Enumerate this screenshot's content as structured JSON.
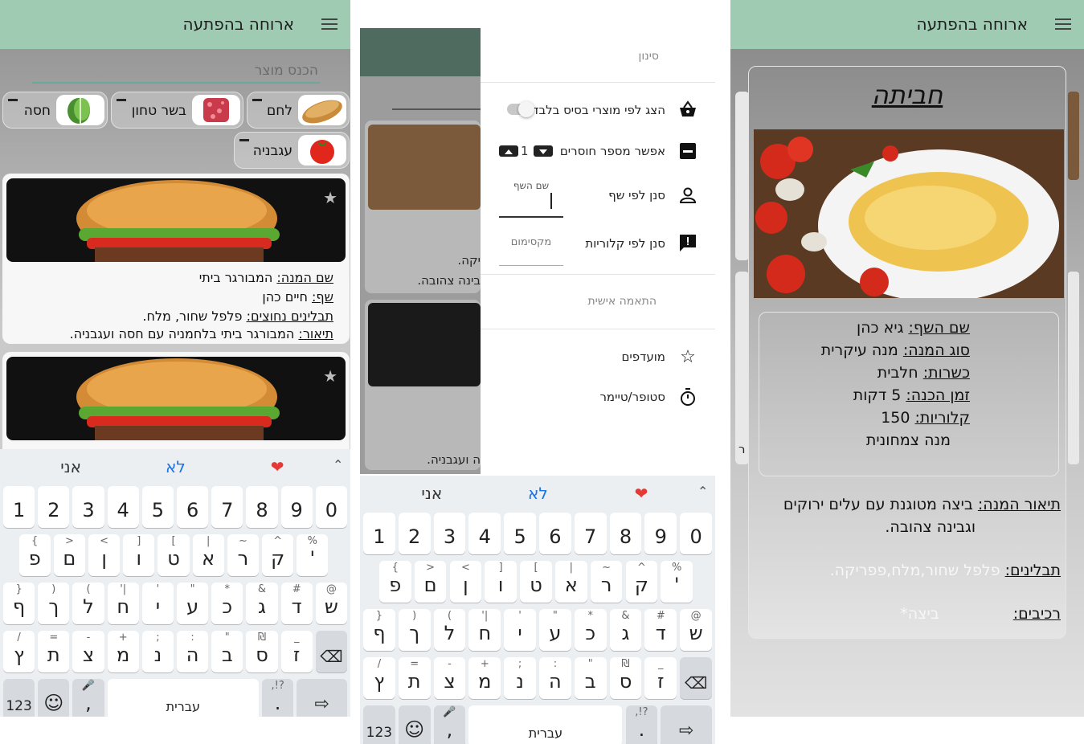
{
  "app": {
    "title": "ארוחה בהפתעה"
  },
  "screen1": {
    "search_placeholder": "הכנס מוצר",
    "chips": [
      "לחם",
      "בשר טחון",
      "חסה",
      "עגבניה"
    ],
    "cards": [
      {
        "name_label": "שם המנה:",
        "name": "המבורגר ביתי",
        "chef_label": "שף:",
        "chef": "חיים כהן",
        "spices_label": "תבלינים נחוצים:",
        "spices": "פלפל שחור, מלח.",
        "desc_label": "תיאור:",
        "desc": "המבורגר ביתי בלחמניה עם חסה ועגבניה."
      }
    ]
  },
  "keyboard": {
    "suggestions": [
      "אני",
      "לא",
      "❤"
    ],
    "numbers": [
      "1",
      "2",
      "3",
      "4",
      "5",
      "6",
      "7",
      "8",
      "9",
      "0"
    ],
    "row2": [
      [
        "%",
        "'"
      ],
      [
        "^",
        "ק"
      ],
      [
        "~",
        "ר"
      ],
      [
        "|",
        "א"
      ],
      [
        "[",
        "ט"
      ],
      [
        "]",
        "ו"
      ],
      [
        "<",
        "ן"
      ],
      [
        ">",
        "ם"
      ],
      [
        "{",
        "פ"
      ]
    ],
    "row3": [
      [
        "@",
        "ש"
      ],
      [
        "#",
        "ד"
      ],
      [
        "&",
        "ג"
      ],
      [
        "*",
        "כ"
      ],
      [
        "\"",
        "ע"
      ],
      [
        "'",
        "י"
      ],
      [
        "'|",
        "ח"
      ],
      [
        "(",
        "ל"
      ],
      [
        ")",
        "ך"
      ],
      [
        "}",
        "ף"
      ]
    ],
    "row4": [
      [
        "_",
        "ז"
      ],
      [
        "₪",
        "ס"
      ],
      [
        "\"",
        "ב"
      ],
      [
        ":",
        "ה"
      ],
      [
        ";",
        "נ"
      ],
      [
        "+",
        "מ"
      ],
      [
        "-",
        "צ"
      ],
      [
        "=",
        "ת"
      ],
      [
        "/",
        "ץ"
      ]
    ],
    "num_key": "123",
    "space_label": "עברית",
    "comma": ",",
    "period": ".",
    "punct_hint": ",!?"
  },
  "screen2": {
    "section_filter": "סינון",
    "items": [
      {
        "label": "הצג לפי מוצרי בסיס בלבד"
      },
      {
        "label": "אפשר מספר חוסרים",
        "value": "1"
      },
      {
        "label": "סנן לפי שף",
        "hint": "שם השף"
      },
      {
        "label": "סנן לפי קלוריות",
        "hint": "מקסימום"
      }
    ],
    "section_personal": "התאמה אישית",
    "favorites": "מועדפים",
    "stopwatch": "סטופר/טיימר",
    "bg_snippets": [
      "יקה.",
      "בינה צהובה.",
      "ה ועגבניה."
    ]
  },
  "screen3": {
    "title": "חביתה",
    "info": [
      {
        "label": "שם השף:",
        "value": "גיא כהן"
      },
      {
        "label": "סוג המנה:",
        "value": "מנה עיקרית"
      },
      {
        "label": "כשרות:",
        "value": "חלבית"
      },
      {
        "label": "זמן הכנה:",
        "value": "5 דקות"
      },
      {
        "label": "קלוריות:",
        "value": "150"
      }
    ],
    "vegetarian": "מנה צמחונית",
    "desc_label": "תיאור המנה:",
    "desc_line1": "ביצה מטוגנת עם עלים ירוקים",
    "desc_line2": "וגבינה צהובה.",
    "spices_label": "תבלינים:",
    "spices": "פלפל שחור,מלח,פפריקה.",
    "ingredients_label": "רכיבים:",
    "ingredients": "ביצה*",
    "side_letter": "ר"
  }
}
